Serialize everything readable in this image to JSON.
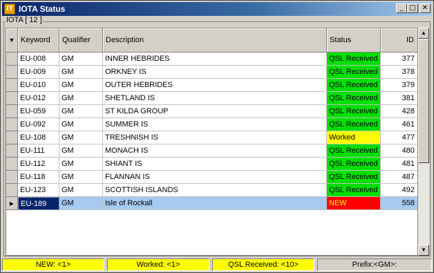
{
  "window": {
    "title": "IOTA Status"
  },
  "title_buttons": {
    "minimize": "_",
    "maximize": "□",
    "close": "✕"
  },
  "group": {
    "label": "IOTA [ 12 ]"
  },
  "colors": {
    "qsl_received": "#00e000",
    "worked": "#ffff00",
    "new": "#ff0000",
    "selected": "#a6caf0"
  },
  "columns": {
    "keyword": "Keyword",
    "qualifier": "Qualifier",
    "description": "Description",
    "status": "Status",
    "id": "ID"
  },
  "rows": [
    {
      "keyword": "EU-008",
      "qualifier": "GM",
      "description": "INNER HEBRIDES",
      "status": "QSL Received",
      "id": "377"
    },
    {
      "keyword": "EU-009",
      "qualifier": "GM",
      "description": "ORKNEY IS",
      "status": "QSL Received",
      "id": "378"
    },
    {
      "keyword": "EU-010",
      "qualifier": "GM",
      "description": "OUTER HEBRIDES",
      "status": "QSL Received",
      "id": "379"
    },
    {
      "keyword": "EU-012",
      "qualifier": "GM",
      "description": "SHETLAND IS",
      "status": "QSL Received",
      "id": "381"
    },
    {
      "keyword": "EU-059",
      "qualifier": "GM",
      "description": "ST KILDA GROUP",
      "status": "QSL Received",
      "id": "428"
    },
    {
      "keyword": "EU-092",
      "qualifier": "GM",
      "description": "SUMMER IS",
      "status": "QSL Received",
      "id": "461"
    },
    {
      "keyword": "EU-108",
      "qualifier": "GM",
      "description": "TRESHNISH IS",
      "status": "Worked",
      "id": "477"
    },
    {
      "keyword": "EU-111",
      "qualifier": "GM",
      "description": "MONACH IS",
      "status": "QSL Received",
      "id": "480"
    },
    {
      "keyword": "EU-112",
      "qualifier": "GM",
      "description": "SHIANT IS",
      "status": "QSL Received",
      "id": "481"
    },
    {
      "keyword": "EU-118",
      "qualifier": "GM",
      "description": "FLANNAN IS",
      "status": "QSL Received",
      "id": "487"
    },
    {
      "keyword": "EU-123",
      "qualifier": "GM",
      "description": "SCOTTISH ISLANDS",
      "status": "QSL Received",
      "id": "492"
    },
    {
      "keyword": "EU-189",
      "qualifier": "GM",
      "description": "Isle of Rockall",
      "status": "NEW",
      "id": "558",
      "selected": true
    }
  ],
  "statusbar": {
    "new": "NEW: <1>",
    "worked": "Worked: <1>",
    "qsl": "QSL Received: <10>",
    "prefix": "Prefix:<GM>:"
  }
}
